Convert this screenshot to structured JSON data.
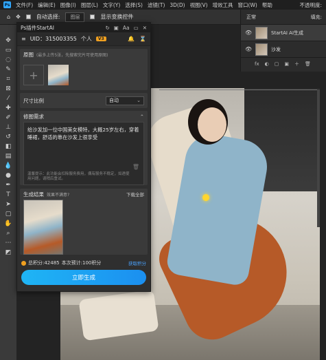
{
  "menubar": {
    "logo": "Ps",
    "items": [
      "文件(F)",
      "编辑(E)",
      "图像(I)",
      "图层(L)",
      "文字(Y)",
      "选择(S)",
      "滤镜(T)",
      "3D(D)",
      "视图(V)",
      "增效工具",
      "窗口(W)",
      "帮助"
    ],
    "right_text": "不透明度:"
  },
  "optbar": {
    "auto_select_label": "自动选择:",
    "auto_select_value": "图层",
    "transform_label": "显示变换控件"
  },
  "right_panel": {
    "mode": "正常",
    "fill_label": "填充:",
    "layers": [
      {
        "name": "StartAI AI生成",
        "active": true
      },
      {
        "name": "沙发",
        "active": false
      }
    ],
    "footer_icons": [
      "fx",
      "◐",
      "▢",
      "▣",
      "＋",
      "🗑"
    ]
  },
  "plugin": {
    "title": "Ps插件StartAI",
    "uid": "UID：315003355",
    "account": "个人",
    "vip": "V3",
    "original_section": {
      "label": "原图",
      "hint": "(最多上传5张，先搜索完片可使用原图)"
    },
    "size_section": {
      "label": "尺寸比例",
      "value": "自动"
    },
    "prompt_section": {
      "label": "修图需求",
      "text": "给沙发加一位中国美女模特，大概25岁左右，穿着睡裙，舒适的靠在沙发上很享受",
      "note": "温馨提示：此功能会扣除服务费用，偶有服务不稳定，如遇使用问题，请稍后重试。"
    },
    "result_section": {
      "label": "生成结果",
      "unsatisfied": "效果不满意?",
      "download": "下载全部"
    },
    "points": {
      "total": "总积分:42485",
      "estimate": "本次预计:100积分",
      "get": "获取积分"
    },
    "generate_button": "立即生成"
  }
}
